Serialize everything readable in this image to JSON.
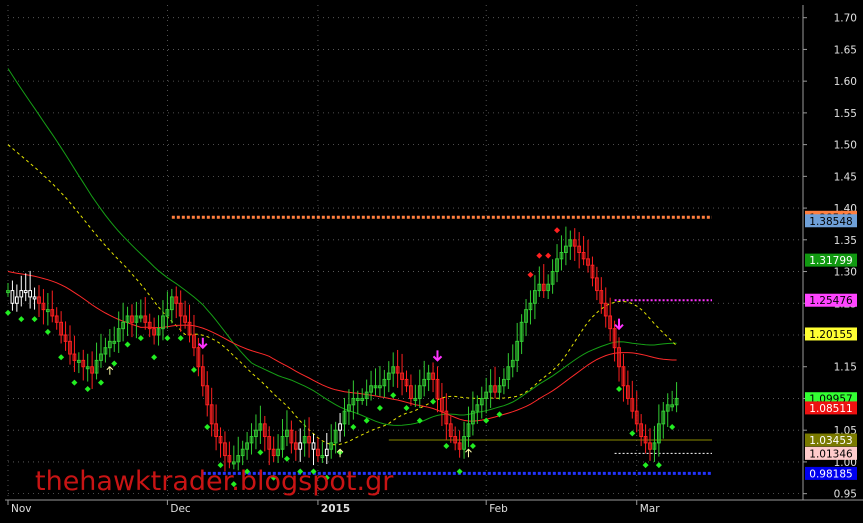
{
  "watermark": "thehawktrader.blogspot.gr",
  "chart_data": {
    "type": "candlestick",
    "y_axis": {
      "range": [
        0.94,
        1.72
      ],
      "ticks": [
        "1.70",
        "1.65",
        "1.60",
        "1.55",
        "1.50",
        "1.45",
        "1.40",
        "1.35",
        "1.30",
        "1.25",
        "1.20",
        "1.15",
        "1.10",
        "1.05",
        "1.00",
        "0.95"
      ],
      "tick_values": [
        1.7,
        1.65,
        1.6,
        1.55,
        1.5,
        1.45,
        1.4,
        1.35,
        1.3,
        1.25,
        1.2,
        1.15,
        1.1,
        1.05,
        1.0,
        0.95
      ],
      "position": "right"
    },
    "x_axis": {
      "labels": [
        "Nov",
        "Dec",
        "2015",
        "Feb",
        "Mar"
      ],
      "label_bars": [
        0,
        36,
        70,
        108,
        142
      ]
    },
    "bar_count": 160,
    "closes": [
      1.27,
      1.25,
      1.26,
      1.27,
      1.27,
      1.26,
      1.26,
      1.25,
      1.24,
      1.24,
      1.23,
      1.22,
      1.2,
      1.19,
      1.17,
      1.16,
      1.16,
      1.15,
      1.15,
      1.14,
      1.16,
      1.17,
      1.18,
      1.19,
      1.19,
      1.21,
      1.22,
      1.23,
      1.22,
      1.23,
      1.23,
      1.22,
      1.21,
      1.2,
      1.21,
      1.23,
      1.24,
      1.26,
      1.25,
      1.23,
      1.22,
      1.2,
      1.18,
      1.15,
      1.12,
      1.09,
      1.06,
      1.04,
      1.03,
      1.01,
      1.0,
      1.0,
      1.01,
      1.02,
      1.03,
      1.04,
      1.05,
      1.06,
      1.04,
      1.02,
      1.01,
      1.02,
      1.04,
      1.05,
      1.03,
      1.02,
      1.03,
      1.04,
      1.03,
      1.02,
      1.01,
      1.01,
      1.02,
      1.03,
      1.05,
      1.06,
      1.08,
      1.09,
      1.1,
      1.1,
      1.1,
      1.11,
      1.12,
      1.12,
      1.12,
      1.13,
      1.14,
      1.15,
      1.14,
      1.13,
      1.12,
      1.1,
      1.1,
      1.12,
      1.13,
      1.14,
      1.13,
      1.1,
      1.08,
      1.06,
      1.04,
      1.03,
      1.02,
      1.04,
      1.06,
      1.08,
      1.09,
      1.1,
      1.11,
      1.12,
      1.11,
      1.12,
      1.13,
      1.15,
      1.16,
      1.19,
      1.22,
      1.24,
      1.25,
      1.27,
      1.28,
      1.27,
      1.28,
      1.3,
      1.32,
      1.33,
      1.34,
      1.35,
      1.34,
      1.33,
      1.32,
      1.31,
      1.29,
      1.27,
      1.25,
      1.23,
      1.21,
      1.18,
      1.15,
      1.12,
      1.1,
      1.08,
      1.06,
      1.04,
      1.03,
      1.02,
      1.03,
      1.06,
      1.08,
      1.09,
      1.09,
      1.1
    ],
    "colors": {
      "up": "#33cc33",
      "down": "#ff2020",
      "neutral": "#ffffff",
      "ma_green": "#16a016",
      "ma_yellow": "#e6e600",
      "ma_red": "#ff2a2a",
      "resistance": "#ff7f3f",
      "support": "#2233ff",
      "pink_line": "#ff33ff"
    },
    "price_labels": [
      {
        "value": "1.38548",
        "y": 1.3855,
        "bg": "#ff7f3f",
        "fg": "#000000"
      },
      {
        "value": "1.38548",
        "y": 1.38,
        "bg": "#6fa0d8",
        "fg": "#000000"
      },
      {
        "value": "1.31799",
        "y": 1.318,
        "bg": "#119911",
        "fg": "#ffffff"
      },
      {
        "value": "1.25476",
        "y": 1.2548,
        "bg": "#ff44ff",
        "fg": "#000000"
      },
      {
        "value": "1.20155",
        "y": 1.2016,
        "bg": "#ffff33",
        "fg": "#000000"
      },
      {
        "value": "1.09957",
        "y": 1.0996,
        "bg": "#33ff33",
        "fg": "#000000"
      },
      {
        "value": "1.08511",
        "y": 1.0851,
        "bg": "#ee1111",
        "fg": "#ffffff"
      },
      {
        "value": "1.03453",
        "y": 1.0345,
        "bg": "#7a7a00",
        "fg": "#ffffff"
      },
      {
        "value": "1.01346",
        "y": 1.0135,
        "bg": "#ffcccc",
        "fg": "#000000"
      },
      {
        "value": "0.98185",
        "y": 0.9819,
        "bg": "#0000ee",
        "fg": "#ffffff"
      }
    ],
    "levels": [
      {
        "name": "resistance",
        "value": 1.3855,
        "from_bar": 37,
        "to_bar": 159
      },
      {
        "name": "support",
        "value": 0.9819,
        "from_bar": 44,
        "to_bar": 159
      },
      {
        "name": "olive",
        "value": 1.0345,
        "from_bar": 86,
        "to_bar": 159
      },
      {
        "name": "pink",
        "value": 1.2548,
        "from_bar": 137,
        "to_bar": 159
      },
      {
        "name": "white",
        "value": 1.0135,
        "from_bar": 137,
        "to_bar": 159
      }
    ],
    "arrows_down": [
      44,
      97,
      138
    ],
    "arrows_up": [
      23,
      75,
      104,
      154
    ]
  }
}
